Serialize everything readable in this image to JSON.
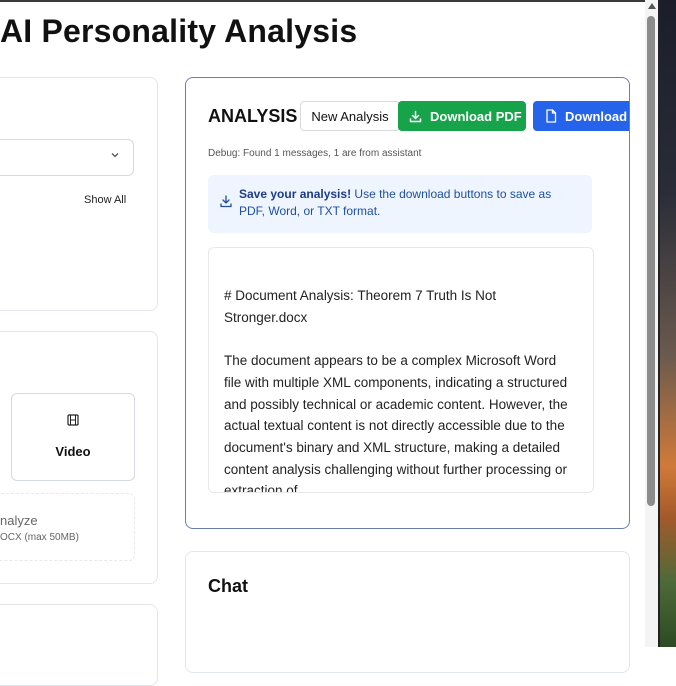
{
  "page": {
    "title": "AI Personality Analysis"
  },
  "left_panel": {
    "show_all_label": "Show All",
    "video_option_label": "Video",
    "upload_text": "nalyze",
    "upload_subtext": "OCX (max 50MB)"
  },
  "analysis": {
    "heading": "ANALYSIS",
    "new_analysis_label": "New Analysis",
    "download_pdf_label": "Download PDF",
    "download_word_label": "Download Wo",
    "debug_text": "Debug: Found 1 messages, 1 are from assistant",
    "info_bold": "Save your analysis!",
    "info_text": " Use the download buttons to save as PDF, Word, or TXT format.",
    "content": "# Document Analysis: Theorem 7 Truth Is Not Stronger.docx\n\nThe document appears to be a complex Microsoft Word file with multiple XML components, indicating a structured and possibly technical or academic content. However, the actual textual content is not directly accessible due to the document's binary and XML structure, making a detailed content analysis challenging without further processing or extraction of"
  },
  "chat": {
    "title": "Chat"
  },
  "colors": {
    "pdf_button": "#16a34a",
    "word_button": "#2563eb",
    "info_background": "#eef5fe",
    "analysis_border": "#6a7fb0"
  },
  "icons": {
    "dropdown": "chevron-down-icon",
    "video": "film-icon",
    "pdf": "download-icon",
    "word": "file-icon",
    "info": "download-icon"
  }
}
